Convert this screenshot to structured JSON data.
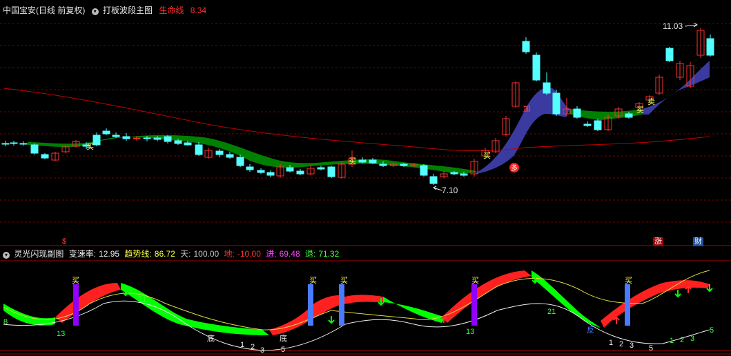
{
  "main_header": {
    "ticker": "中国宝安(日线 前复权)",
    "indicator_name": "打板波段主图",
    "lifeline_label": "生命线",
    "lifeline_value": "8.34"
  },
  "main_chart": {
    "high_label": "11.03",
    "low_label": "7.10",
    "buy_marker": "买",
    "sell_marker": "卖",
    "add_marker": "加",
    "duo_marker": "多",
    "bottom_badges": {
      "dollar": "$",
      "zhang": "涨",
      "cai": "财"
    }
  },
  "sub_header": {
    "name": "灵光闪现副图",
    "items": [
      {
        "label": "变速率:",
        "value": "12.95"
      },
      {
        "label": "趋势线:",
        "value": "86.72"
      },
      {
        "label": "天:",
        "value": "100.00"
      },
      {
        "label": "地:",
        "value": "-10.00"
      },
      {
        "label": "进:",
        "value": "69.48"
      },
      {
        "label": "退:",
        "value": "71.32"
      }
    ]
  },
  "sub_chart": {
    "buy_marker": "买",
    "bottom_marker": "底",
    "fan_marker": "反",
    "counts": [
      "13",
      "21",
      "8",
      "1",
      "2",
      "3",
      "5",
      "13",
      "21",
      "1",
      "2",
      "3",
      "5",
      "1",
      "2",
      "3",
      "5"
    ]
  },
  "colors": {
    "bull": "#ff3030",
    "bear": "#54ffff",
    "ribbon_green": "#008000",
    "ribbon_blue": "#3a3aa0",
    "lifeline": "#c00000",
    "grid": "#8b0000"
  }
}
